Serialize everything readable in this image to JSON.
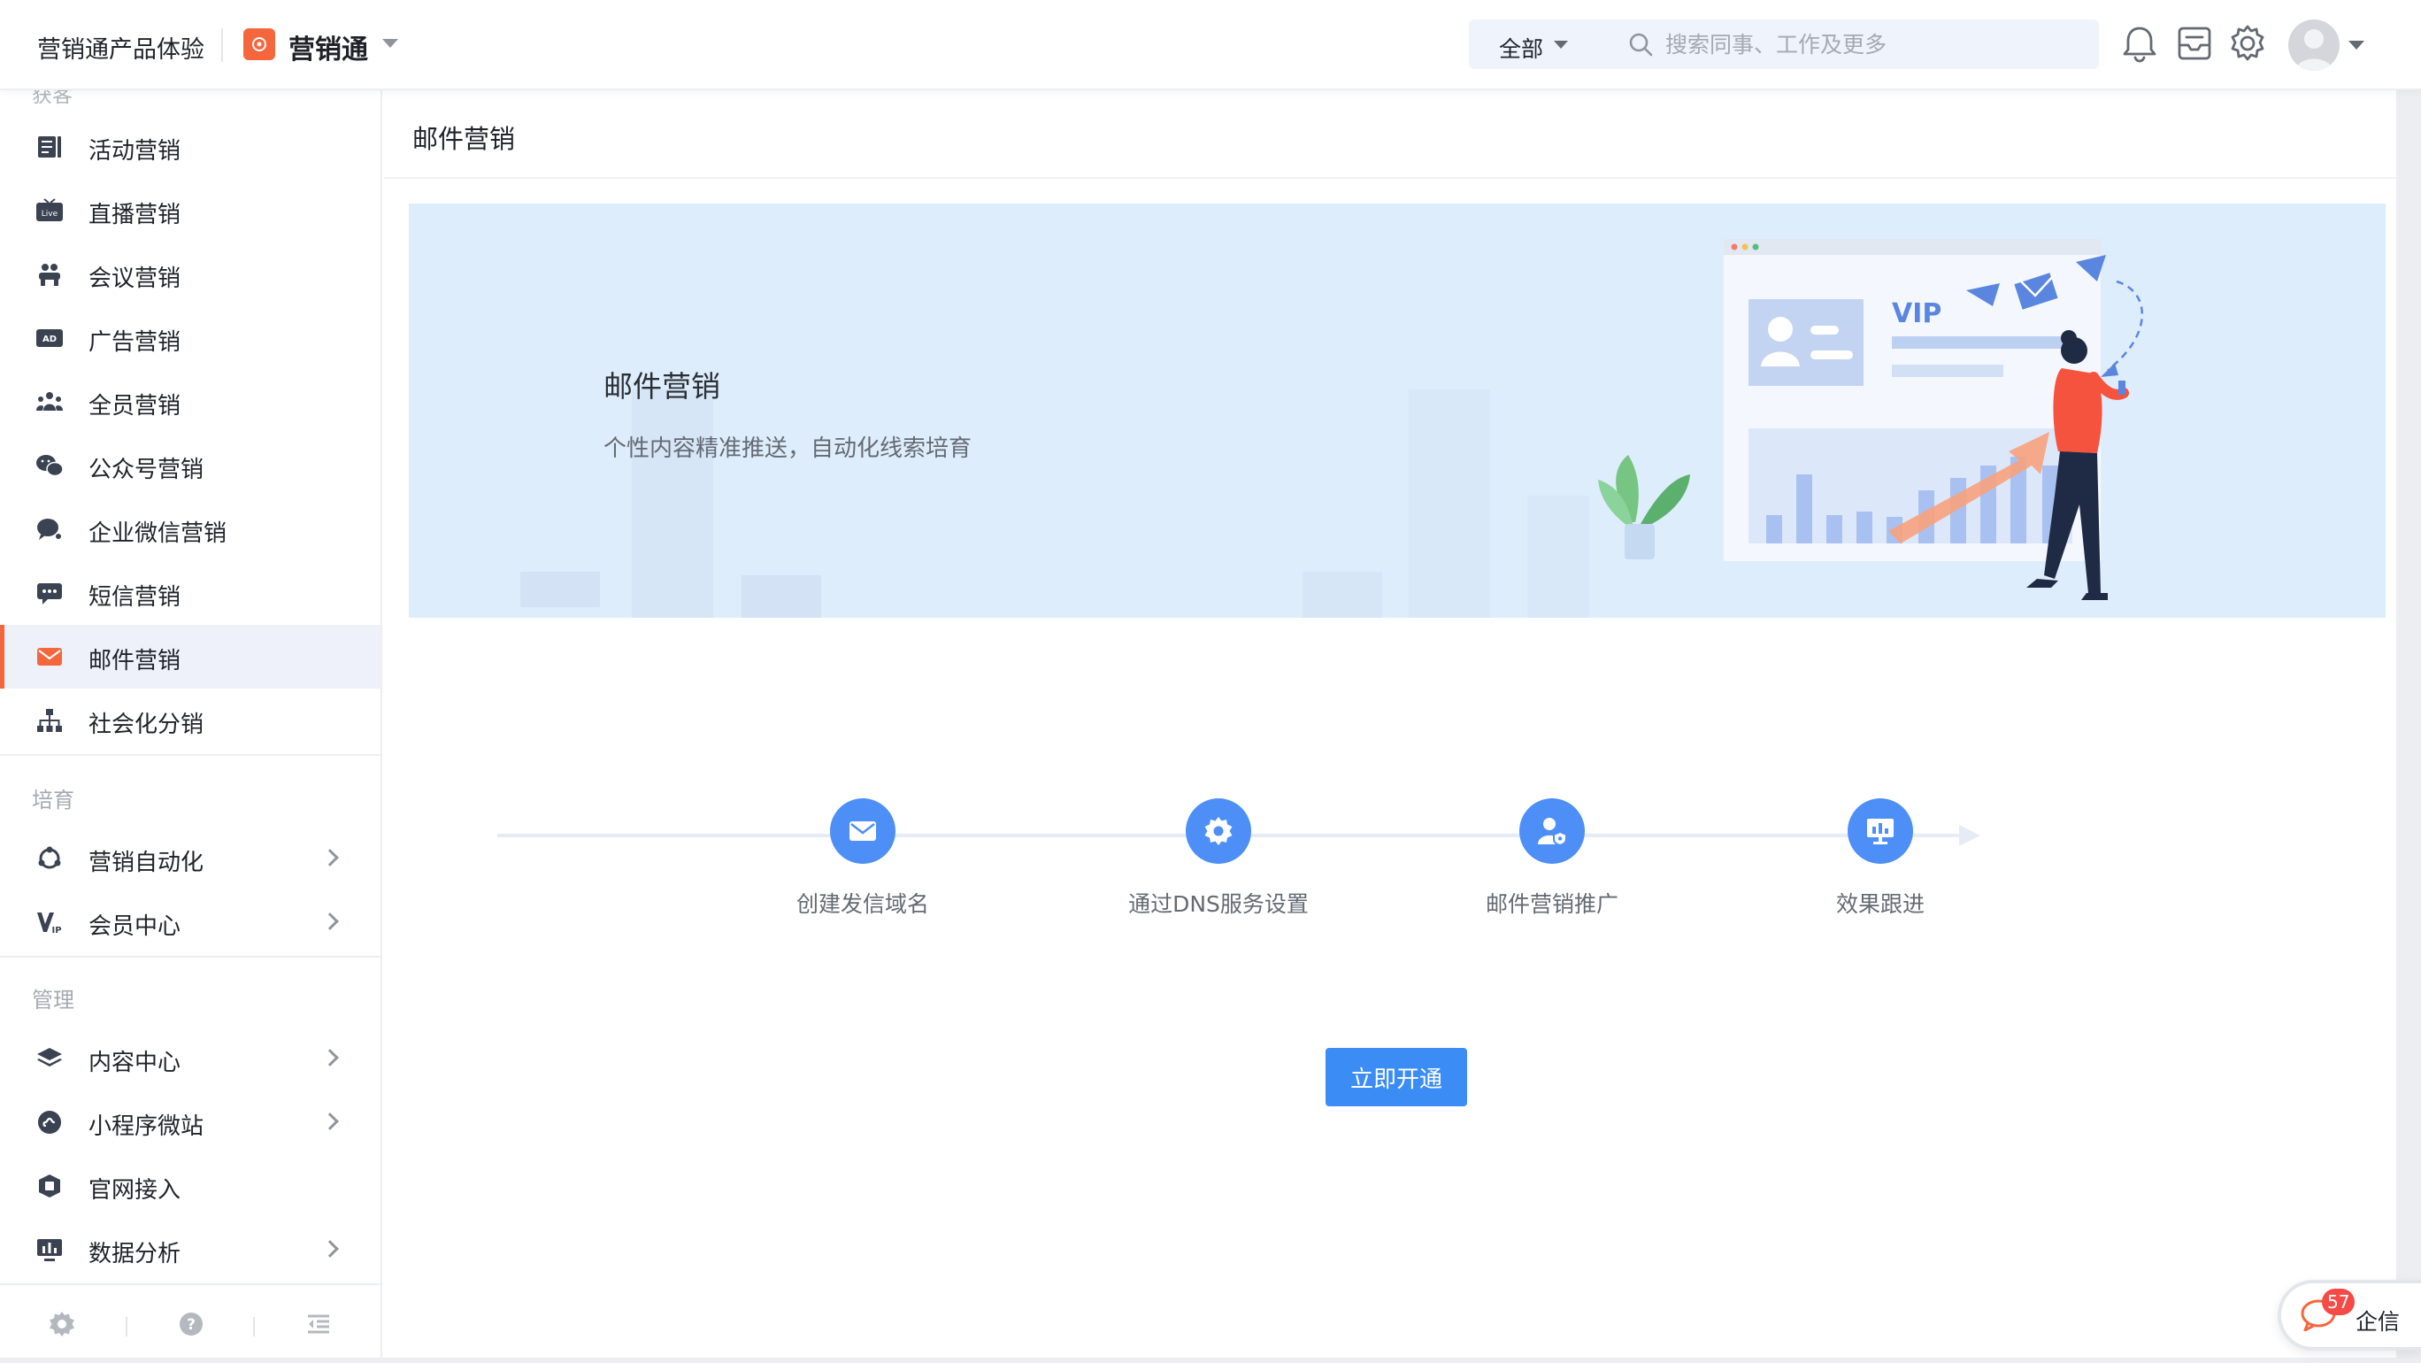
{
  "header": {
    "workspace_name": "营销通产品体验",
    "app_name": "营销通",
    "search_scope": "全部",
    "search_placeholder": "搜索同事、工作及更多",
    "icons": [
      "bell-icon",
      "inbox-icon",
      "settings-icon",
      "avatar"
    ]
  },
  "sidebar": {
    "cut_section_title": "获客",
    "items": [
      {
        "label": "活动营销",
        "icon": "document-icon"
      },
      {
        "label": "直播营销",
        "icon": "live-icon"
      },
      {
        "label": "会议营销",
        "icon": "meeting-icon"
      },
      {
        "label": "广告营销",
        "icon": "ad-icon"
      },
      {
        "label": "全员营销",
        "icon": "team-icon"
      },
      {
        "label": "公众号营销",
        "icon": "wechat-official-icon"
      },
      {
        "label": "企业微信营销",
        "icon": "wecom-icon"
      },
      {
        "label": "短信营销",
        "icon": "sms-icon"
      },
      {
        "label": "邮件营销",
        "icon": "email-icon",
        "active": true
      },
      {
        "label": "社会化分销",
        "icon": "org-tree-icon"
      }
    ],
    "nurture_title": "培育",
    "nurture_items": [
      {
        "label": "营销自动化",
        "icon": "automation-icon"
      },
      {
        "label": "会员中心",
        "icon": "vip-icon"
      }
    ],
    "manage_title": "管理",
    "manage_items": [
      {
        "label": "内容中心",
        "icon": "layers-icon"
      },
      {
        "label": "小程序微站",
        "icon": "miniprogram-icon"
      },
      {
        "label": "官网接入",
        "icon": "website-icon"
      },
      {
        "label": "数据分析",
        "icon": "analytics-icon"
      }
    ]
  },
  "main": {
    "page_title": "邮件营销",
    "banner": {
      "title": "邮件营销",
      "subtitle": "个性内容精准推送，自动化线索培育",
      "illustration_text": "VIP"
    },
    "steps": [
      {
        "label": "创建发信域名",
        "icon": "mail-icon"
      },
      {
        "label": "通过DNS服务设置",
        "icon": "gear-icon"
      },
      {
        "label": "邮件营销推广",
        "icon": "user-shield-icon"
      },
      {
        "label": "效果跟进",
        "icon": "monitor-chart-icon"
      }
    ],
    "open_button": "立即开通"
  },
  "chat_widget": {
    "badge": "57",
    "label": "企信"
  },
  "colors": {
    "accent": "#3b8cf5",
    "brand": "#f5663d",
    "banner_bg": "#deedfb",
    "active_item_bg": "#eef1f9",
    "badge": "#f54a45"
  }
}
